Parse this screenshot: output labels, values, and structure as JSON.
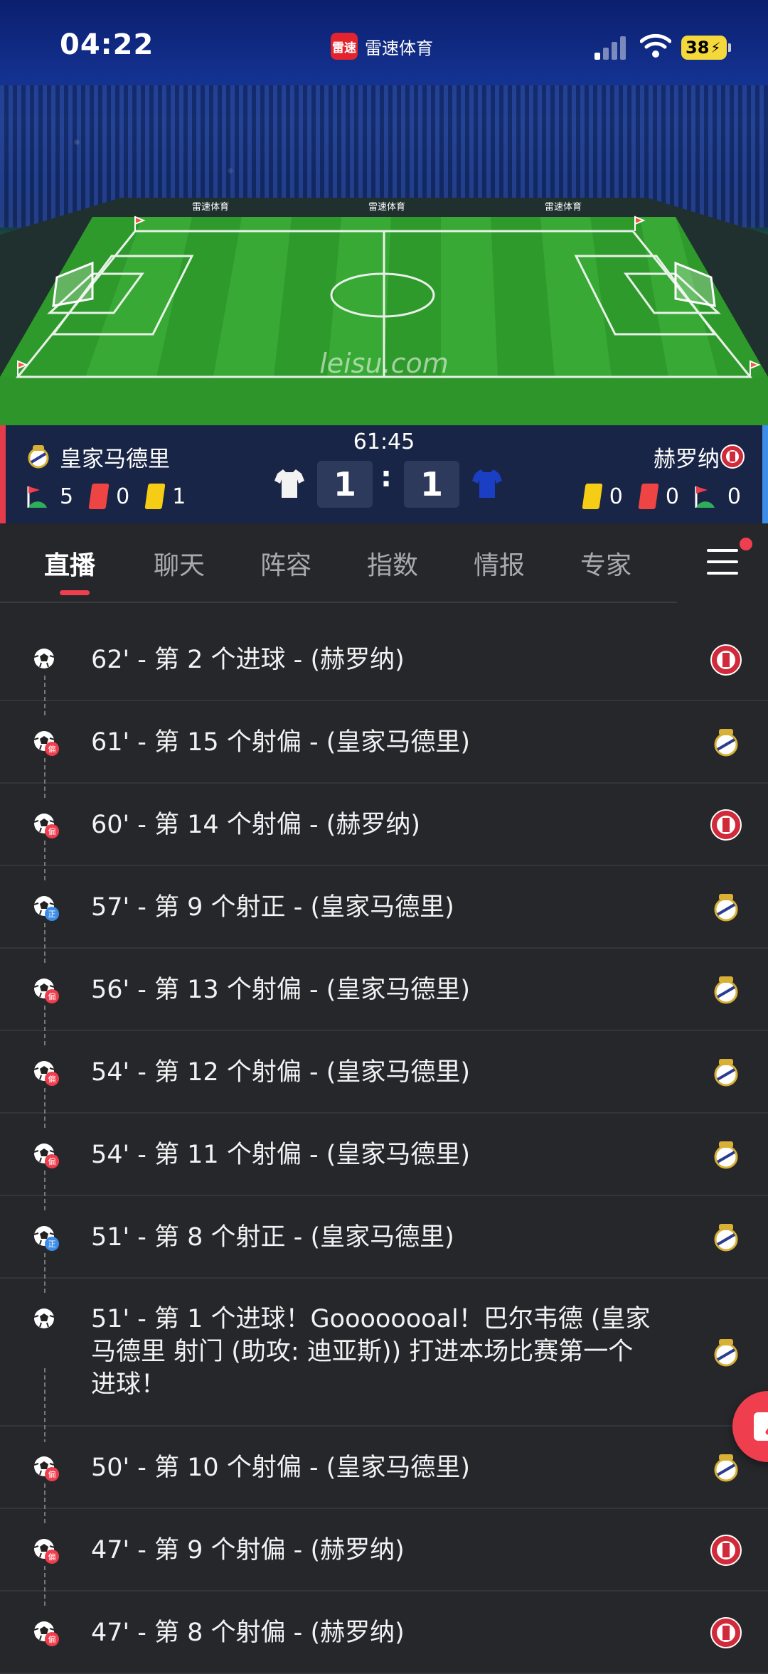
{
  "status_bar": {
    "time": "04:22",
    "app_name": "雷速体育",
    "app_logo_text": "雷速",
    "battery": "38"
  },
  "pitch": {
    "watermark": "leisu.com",
    "board_text": "雷速体育"
  },
  "match": {
    "clock": "61:45",
    "home": {
      "name": "皇家马德里",
      "score": "1",
      "corners": "5",
      "red_cards": "0",
      "yellow_cards": "1",
      "jersey_color": "#f2f2f2"
    },
    "away": {
      "name": "赫罗纳",
      "score": "1",
      "corners": "0",
      "red_cards": "0",
      "yellow_cards": "0",
      "jersey_color": "#1a3fc4"
    },
    "separator": ":"
  },
  "tabs": [
    {
      "label": "直播",
      "active": true
    },
    {
      "label": "聊天"
    },
    {
      "label": "阵容"
    },
    {
      "label": "指数"
    },
    {
      "label": "情报"
    },
    {
      "label": "专家"
    }
  ],
  "events": [
    {
      "text": "62' - 第 2 个进球 - (赫罗纳)",
      "icon": "goal-icon",
      "team": "away"
    },
    {
      "text": "61' - 第 15 个射偏 - (皇家马德里)",
      "icon": "shot-off-target-icon",
      "badge": "偏",
      "team": "home"
    },
    {
      "text": "60' - 第 14 个射偏 - (赫罗纳)",
      "icon": "shot-off-target-icon",
      "badge": "偏",
      "team": "away"
    },
    {
      "text": "57' - 第 9 个射正 - (皇家马德里)",
      "icon": "shot-on-target-icon",
      "badge": "正",
      "team": "home"
    },
    {
      "text": "56' - 第 13 个射偏 - (皇家马德里)",
      "icon": "shot-off-target-icon",
      "badge": "偏",
      "team": "home"
    },
    {
      "text": "54' - 第 12 个射偏 - (皇家马德里)",
      "icon": "shot-off-target-icon",
      "badge": "偏",
      "team": "home"
    },
    {
      "text": "54' - 第 11 个射偏 - (皇家马德里)",
      "icon": "shot-off-target-icon",
      "badge": "偏",
      "team": "home"
    },
    {
      "text": "51' - 第 8 个射正 - (皇家马德里)",
      "icon": "shot-on-target-icon",
      "badge": "正",
      "team": "home"
    },
    {
      "text": "51' - 第 1 个进球！Goooooooal！巴尔韦德 (皇家",
      "text2": "马德里 射门 (助攻: 迪亚斯)) 打进本场比赛第一个",
      "text3": "进球！",
      "icon": "goal-icon",
      "team": "home"
    },
    {
      "text": "50' - 第 10 个射偏 - (皇家马德里)",
      "icon": "shot-off-target-icon",
      "badge": "偏",
      "team": "home"
    },
    {
      "text": "47' - 第 9 个射偏 - (赫罗纳)",
      "icon": "shot-off-target-icon",
      "badge": "偏",
      "team": "away"
    },
    {
      "text": "47' - 第 8 个射偏 - (赫罗纳)",
      "icon": "shot-off-target-icon",
      "badge": "偏",
      "team": "away"
    }
  ],
  "colors": {
    "accent_red": "#ef3e4d",
    "home_stripe": "#e63b4a",
    "away_stripe": "#3d8de8",
    "badge_blue": "#3d8de8"
  }
}
